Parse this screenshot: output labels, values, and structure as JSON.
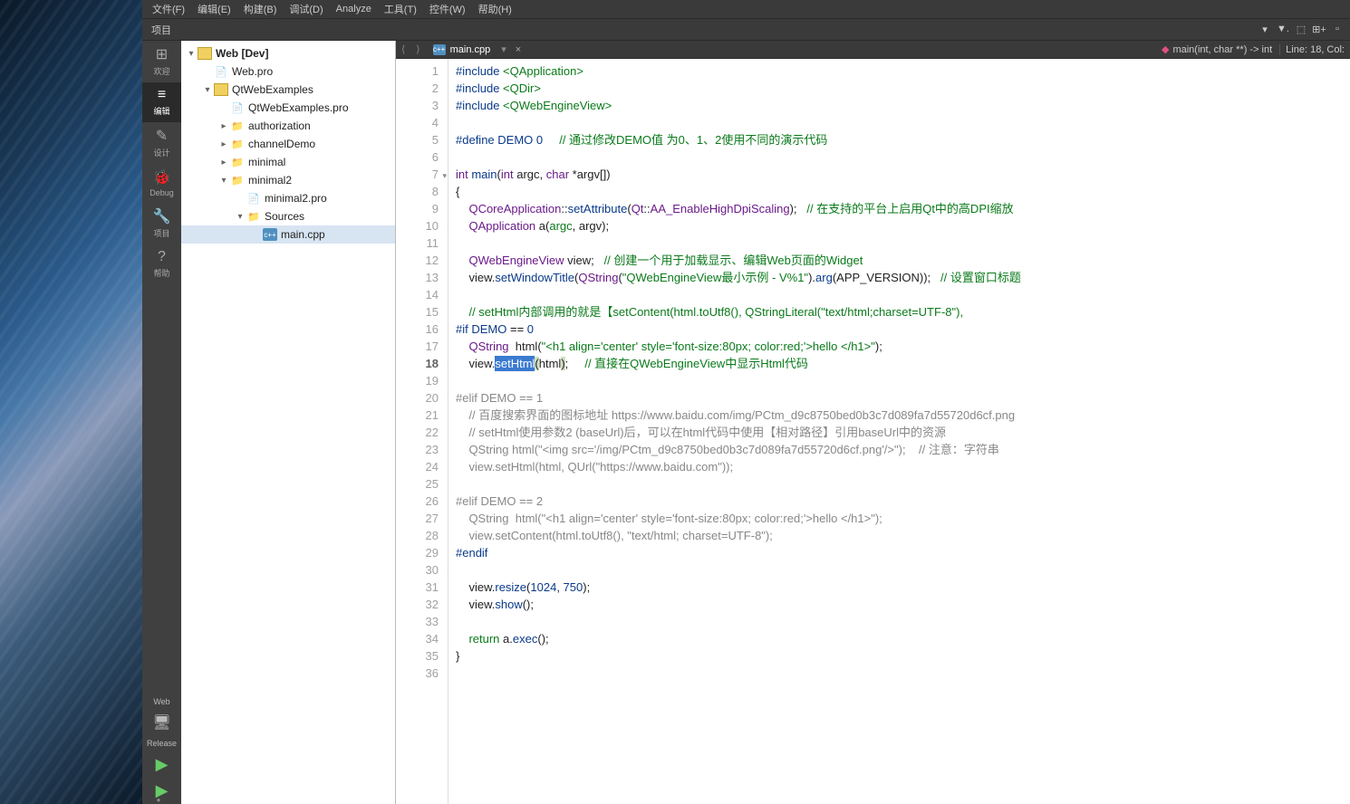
{
  "menu": [
    "文件(F)",
    "编辑(E)",
    "构建(B)",
    "调试(D)",
    "Analyze",
    "工具(T)",
    "控件(W)",
    "帮助(H)"
  ],
  "panel_title": "项目",
  "sidebar": [
    {
      "icon": "⊞",
      "label": "欢迎"
    },
    {
      "icon": "≡",
      "label": "编辑"
    },
    {
      "icon": "✎",
      "label": "设计"
    },
    {
      "icon": "🐞",
      "label": "Debug"
    },
    {
      "icon": "🔧",
      "label": "项目"
    },
    {
      "icon": "?",
      "label": "帮助"
    }
  ],
  "sidebar_bottom": {
    "target": "Web",
    "config": "Release"
  },
  "tree": [
    {
      "d": 0,
      "a": "▾",
      "t": "proj",
      "l": "Web [Dev]",
      "b": true
    },
    {
      "d": 1,
      "a": "",
      "t": "file",
      "l": "Web.pro"
    },
    {
      "d": 1,
      "a": "▾",
      "t": "proj",
      "l": "QtWebExamples"
    },
    {
      "d": 2,
      "a": "",
      "t": "file",
      "l": "QtWebExamples.pro"
    },
    {
      "d": 2,
      "a": "▸",
      "t": "folder",
      "l": "authorization"
    },
    {
      "d": 2,
      "a": "▸",
      "t": "folder",
      "l": "channelDemo"
    },
    {
      "d": 2,
      "a": "▸",
      "t": "folder",
      "l": "minimal"
    },
    {
      "d": 2,
      "a": "▾",
      "t": "folder",
      "l": "minimal2"
    },
    {
      "d": 3,
      "a": "",
      "t": "file",
      "l": "minimal2.pro"
    },
    {
      "d": 3,
      "a": "▾",
      "t": "folder",
      "l": "Sources"
    },
    {
      "d": 4,
      "a": "",
      "t": "cpp",
      "l": "main.cpp",
      "sel": true
    }
  ],
  "tab": {
    "file": "main.cpp",
    "crumb": "main(int, char **) -> int"
  },
  "status": "Line: 18, Col:",
  "gutter_start": 1,
  "gutter_end": 36,
  "fold_lines": [
    7
  ],
  "current_line": 18,
  "code": [
    [
      [
        "pp",
        "#include "
      ],
      [
        "kw",
        "<QApplication>"
      ]
    ],
    [
      [
        "pp",
        "#include "
      ],
      [
        "kw",
        "<QDir>"
      ]
    ],
    [
      [
        "pp",
        "#include "
      ],
      [
        "kw",
        "<QWebEngineView>"
      ]
    ],
    [],
    [
      [
        "pp",
        "#define"
      ],
      [
        "",
        " "
      ],
      [
        "fn",
        "DEMO"
      ],
      [
        "",
        " "
      ],
      [
        "num",
        "0"
      ],
      [
        "",
        "     "
      ],
      [
        "cm",
        "// 通过修改DEMO值 为0、1、2使用不同的演示代码"
      ]
    ],
    [],
    [
      [
        "ty",
        "int "
      ],
      [
        "fn",
        "main"
      ],
      [
        "",
        "("
      ],
      [
        "ty",
        "int"
      ],
      [
        "",
        " argc, "
      ],
      [
        "ty",
        "char"
      ],
      [
        "",
        " *argv[])"
      ]
    ],
    [
      [
        "",
        "{"
      ]
    ],
    [
      [
        "",
        "    "
      ],
      [
        "ty",
        "QCoreApplication"
      ],
      [
        "",
        "::"
      ],
      [
        "fn",
        "setAttribute"
      ],
      [
        "",
        "("
      ],
      [
        "ty",
        "Qt"
      ],
      [
        "",
        "::"
      ],
      [
        "ty",
        "AA_EnableHighDpiScaling"
      ],
      [
        "",
        ");   "
      ],
      [
        "cm",
        "// 在支持的平台上启用Qt中的高DPI缩放"
      ]
    ],
    [
      [
        "",
        "    "
      ],
      [
        "ty",
        "QApplication"
      ],
      [
        "",
        " a("
      ],
      [
        "kw",
        "argc"
      ],
      [
        "",
        ", argv);"
      ]
    ],
    [],
    [
      [
        "",
        "    "
      ],
      [
        "ty",
        "QWebEngineView"
      ],
      [
        "",
        " view;   "
      ],
      [
        "cm",
        "// 创建一个用于加载显示、编辑Web页面的Widget"
      ]
    ],
    [
      [
        "",
        "    view."
      ],
      [
        "fn",
        "setWindowTitle"
      ],
      [
        "",
        "("
      ],
      [
        "ty",
        "QString"
      ],
      [
        "",
        "("
      ],
      [
        "str",
        "\"QWebEngineView最小示例 - V%1\""
      ],
      [
        "",
        ")."
      ],
      [
        "fn",
        "arg"
      ],
      [
        "",
        "(APP_VERSION));   "
      ],
      [
        "cm",
        "// 设置窗口标题"
      ]
    ],
    [],
    [
      [
        "",
        "    "
      ],
      [
        "cm",
        "// setHtml内部调用的就是【setContent(html.toUtf8(), QStringLiteral(\"text/html;charset=UTF-8\"), "
      ]
    ],
    [
      [
        "pp",
        "#if"
      ],
      [
        "",
        " "
      ],
      [
        "fn",
        "DEMO"
      ],
      [
        "",
        " == "
      ],
      [
        "num",
        "0"
      ]
    ],
    [
      [
        "",
        "    "
      ],
      [
        "ty",
        "QString"
      ],
      [
        "",
        "  html("
      ],
      [
        "str",
        "\"<h1 align='center' style='font-size:80px; color:red;'>hello </h1>\""
      ],
      [
        "",
        ");"
      ]
    ],
    [
      [
        "",
        "    view."
      ],
      [
        "hl",
        "setHtml"
      ],
      [
        "hlp",
        "("
      ],
      [
        "",
        "html"
      ],
      [
        "hlp",
        ")"
      ],
      [
        "",
        ";     "
      ],
      [
        "cm",
        "// 直接在QWebEngineView中显示Html代码"
      ]
    ],
    [],
    [
      [
        "dim",
        "#elif DEMO == 1"
      ]
    ],
    [
      [
        "dim",
        "    // 百度搜索界面的图标地址 https://www.baidu.com/img/PCtm_d9c8750bed0b3c7d089fa7d55720d6cf.png"
      ]
    ],
    [
      [
        "dim",
        "    // setHtml使用参数2 (baseUrl)后，可以在html代码中使用【相对路径】引用baseUrl中的资源"
      ]
    ],
    [
      [
        "dim",
        "    QString html(\"<img src='/img/PCtm_d9c8750bed0b3c7d089fa7d55720d6cf.png'/>\");    // 注意：字符串"
      ]
    ],
    [
      [
        "dim",
        "    view.setHtml(html, QUrl(\"https://www.baidu.com\"));"
      ]
    ],
    [],
    [
      [
        "dim",
        "#elif DEMO == 2"
      ]
    ],
    [
      [
        "dim",
        "    QString  html(\"<h1 align='center' style='font-size:80px; color:red;'>hello </h1>\");"
      ]
    ],
    [
      [
        "dim",
        "    view.setContent(html.toUtf8(), \"text/html; charset=UTF-8\");"
      ]
    ],
    [
      [
        "pp",
        "#endif"
      ]
    ],
    [],
    [
      [
        "",
        "    view."
      ],
      [
        "fn",
        "resize"
      ],
      [
        "",
        "("
      ],
      [
        "num",
        "1024"
      ],
      [
        "",
        ", "
      ],
      [
        "num",
        "750"
      ],
      [
        "",
        ");"
      ]
    ],
    [
      [
        "",
        "    view."
      ],
      [
        "fn",
        "show"
      ],
      [
        "",
        "();"
      ]
    ],
    [],
    [
      [
        "",
        "    "
      ],
      [
        "kw",
        "return"
      ],
      [
        "",
        " a."
      ],
      [
        "fn",
        "exec"
      ],
      [
        "",
        "();"
      ]
    ],
    [
      [
        "",
        "}"
      ]
    ],
    []
  ]
}
